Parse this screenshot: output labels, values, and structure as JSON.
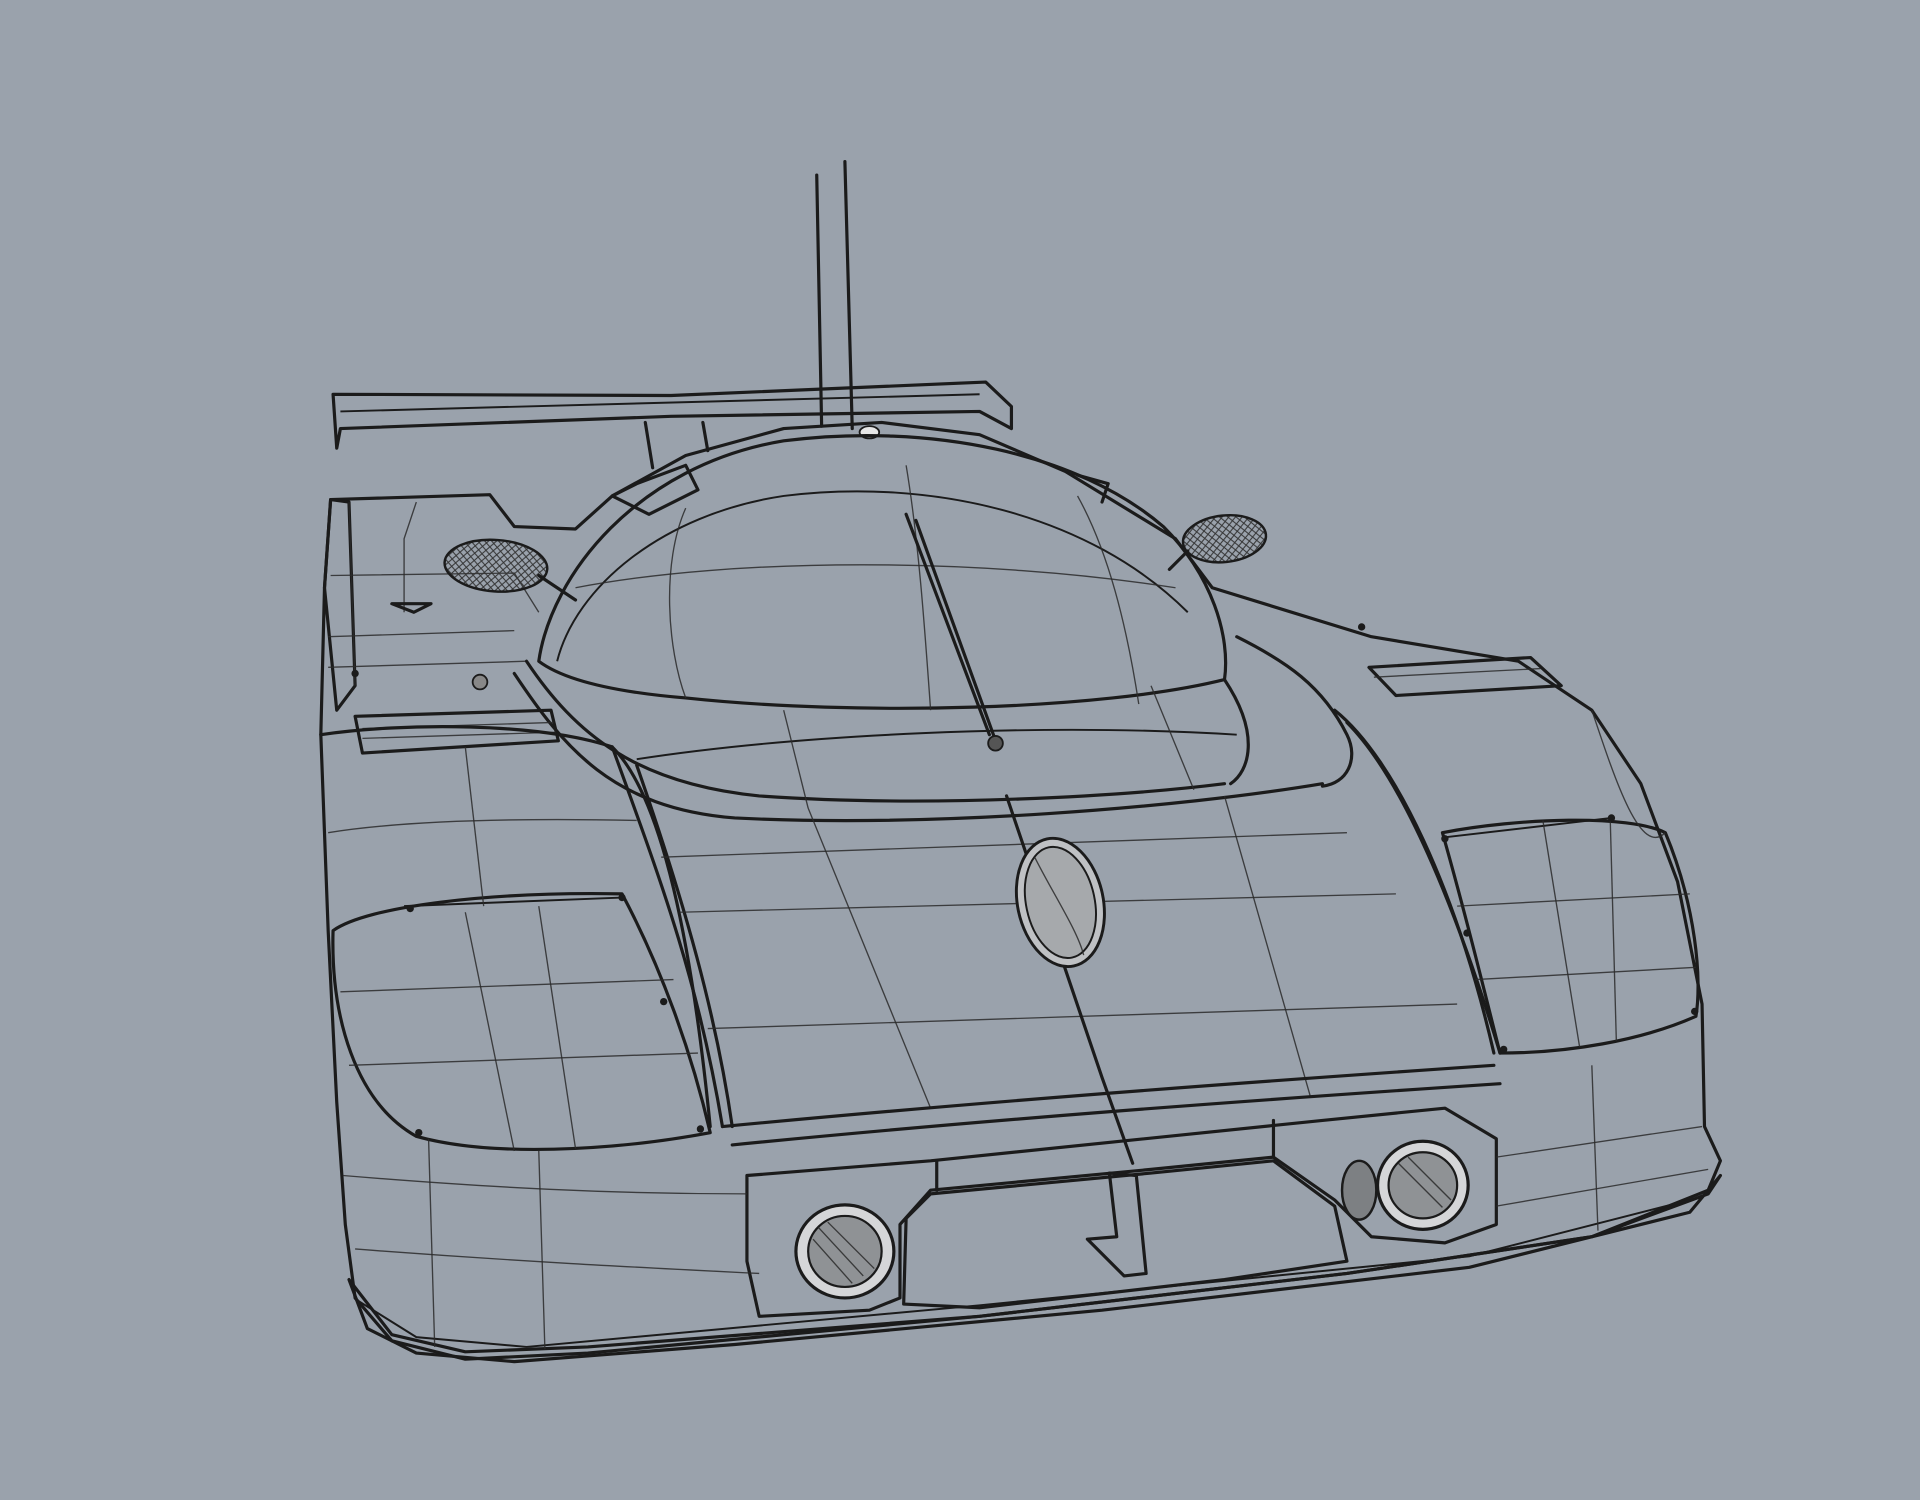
{
  "viewport": {
    "background_color": "#9aa2ac",
    "body_color": "#c9cbce",
    "edge_color": "#1b1b1b"
  },
  "scene": {
    "object": "race-car-model"
  }
}
